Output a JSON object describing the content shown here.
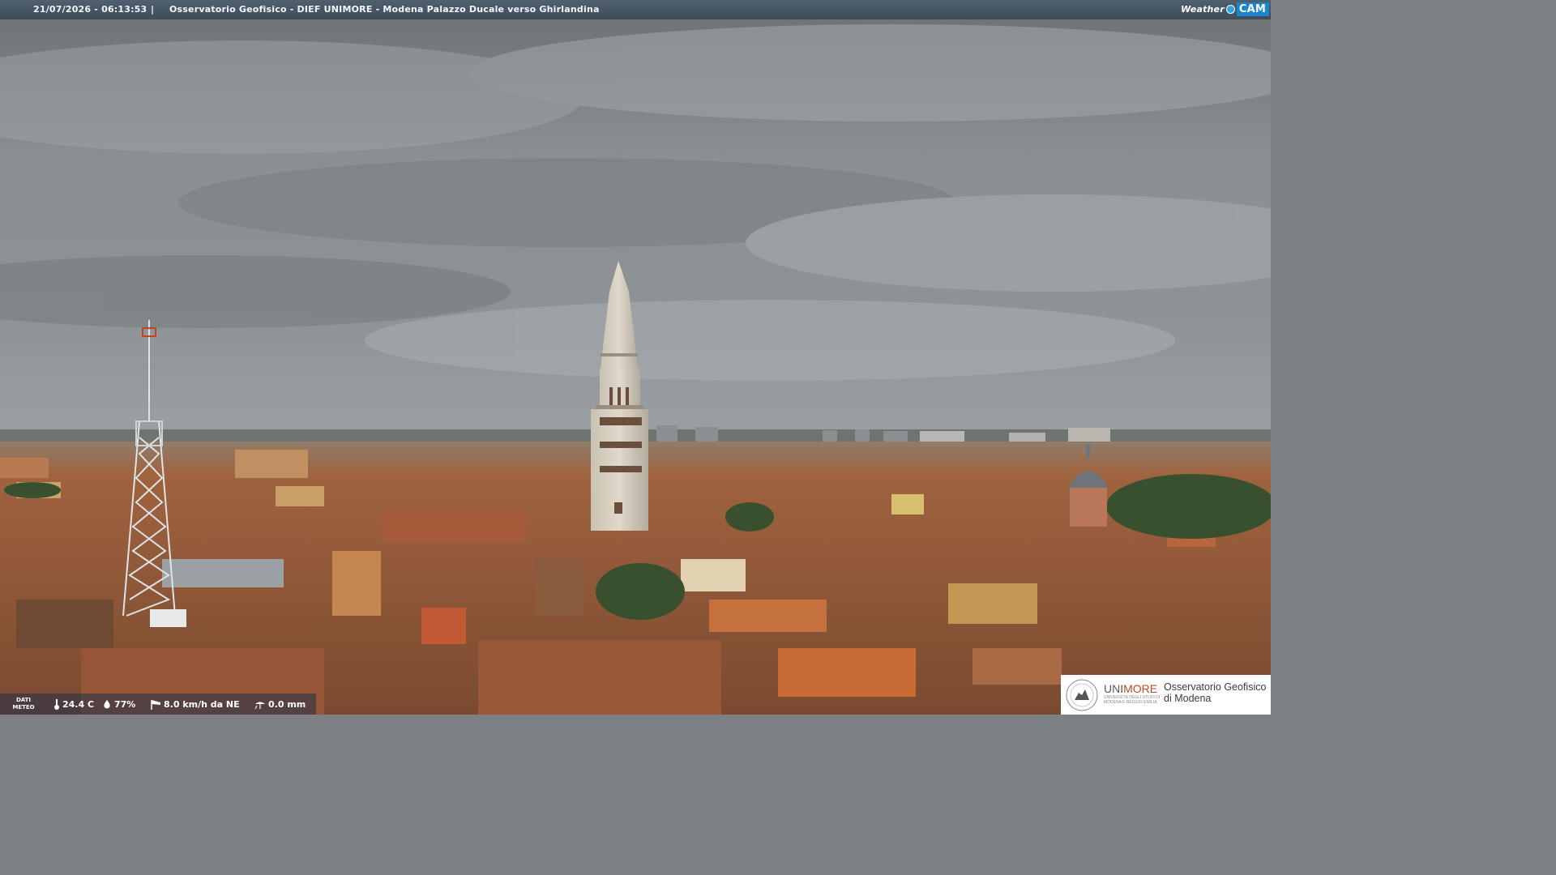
{
  "overlay": {
    "timestamp": "21/07/2026 - 06:13:53",
    "separator": "|",
    "title": "Osservatorio Geofisico - DIEF UNIMORE - Modena Palazzo Ducale verso Ghirlandina"
  },
  "brand": {
    "weather": "Weather",
    "cam": "CAM",
    "icon": "weathercam-logo-icon"
  },
  "meteo": {
    "label_line1": "DATI",
    "label_line2": "METEO",
    "temperature": "24.4 C",
    "humidity": "77%",
    "wind": "8.0 km/h da NE",
    "rain": "0.0 mm",
    "icons": [
      "thermometer-icon",
      "humidity-drop-icon",
      "wind-sock-icon",
      "rain-gauge-icon"
    ]
  },
  "logo": {
    "uni_prefix": "UNI",
    "uni_suffix": "MORE",
    "uni_subtitle": "UNIVERSITÀ DEGLI STUDI DI MODENA E REGGIO EMILIA",
    "observatory_line1": "Osservatorio Geofisico",
    "observatory_line2": "di Modena"
  },
  "colors": {
    "sky": "#8e9396",
    "roofs": "#a5603c",
    "tower": "#d9d2c4",
    "accent": "#c04a1c"
  }
}
